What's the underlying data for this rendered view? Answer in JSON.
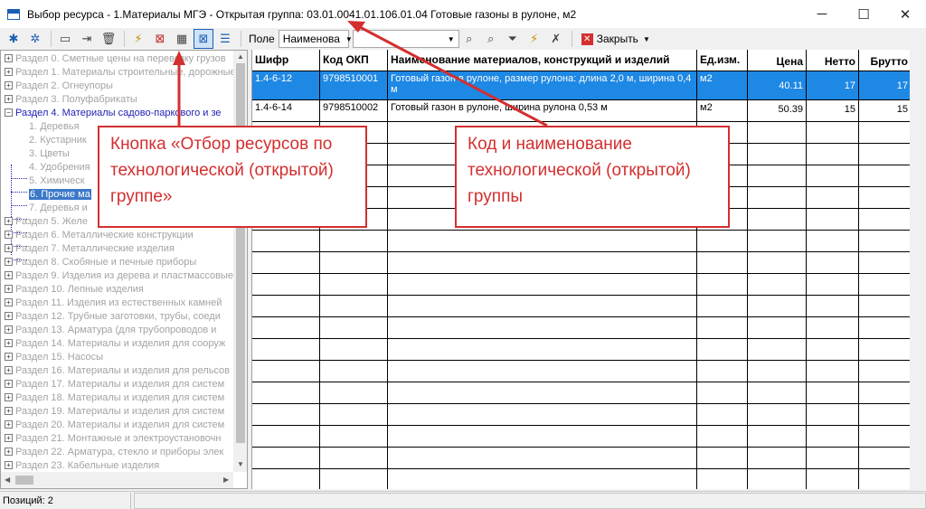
{
  "window": {
    "title": "Выбор ресурса - 1.Материалы МГЭ - Открытая группа: 03.01.0041.01.106.01.04 Готовые газоны в рулоне, м2",
    "minimize": "─",
    "maximize": "☐",
    "close": "✕"
  },
  "toolbar": {
    "field_label": "Поле",
    "field_value": "Наименова",
    "search_value": "",
    "close_label": "Закрыть"
  },
  "tree": {
    "items": [
      {
        "label": "Раздел 0. Сметные цены на перевозку грузов",
        "pm": "+"
      },
      {
        "label": "Раздел 1. Материалы строительные, дорожные",
        "pm": "+"
      },
      {
        "label": "Раздел 2. Огнеупоры",
        "pm": "+"
      },
      {
        "label": "Раздел 3. Полуфабрикаты",
        "pm": "+"
      },
      {
        "label": "Раздел 4. Материалы садово-паркового и зе",
        "pm": "−"
      },
      {
        "label": "1. Деревья"
      },
      {
        "label": "2. Кустарник"
      },
      {
        "label": "3. Цветы"
      },
      {
        "label": "4. Удобрения"
      },
      {
        "label": "5. Химическ"
      },
      {
        "label": "6. Прочие ма"
      },
      {
        "label": "7. Деревья и"
      },
      {
        "label": "Раздел 5. Желе",
        "pm": "+"
      },
      {
        "label": "Раздел 6. Металлические конструкции",
        "pm": "+"
      },
      {
        "label": "Раздел 7. Металлические изделия",
        "pm": "+"
      },
      {
        "label": "Раздел 8. Скобяные и печные приборы",
        "pm": "+"
      },
      {
        "label": "Раздел 9. Изделия из дерева и пластмассовые",
        "pm": "+"
      },
      {
        "label": "Раздел 10. Лепные изделия",
        "pm": "+"
      },
      {
        "label": "Раздел 11. Изделия из естественных камней",
        "pm": "+"
      },
      {
        "label": "Раздел 12. Трубные заготовки, трубы, соеди",
        "pm": "+"
      },
      {
        "label": "Раздел 13. Арматура (для трубопроводов и",
        "pm": "+"
      },
      {
        "label": "Раздел 14. Материалы и изделия для сооруж",
        "pm": "+"
      },
      {
        "label": "Раздел 15. Насосы",
        "pm": "+"
      },
      {
        "label": "Раздел 16. Материалы и изделия для рельсов",
        "pm": "+"
      },
      {
        "label": "Раздел 17. Материалы и изделия для систем",
        "pm": "+"
      },
      {
        "label": "Раздел 18. Материалы и изделия для систем",
        "pm": "+"
      },
      {
        "label": "Раздел 19. Материалы и изделия для систем",
        "pm": "+"
      },
      {
        "label": "Раздел 20. Материалы и изделия для систем",
        "pm": "+"
      },
      {
        "label": "Раздел 21. Монтажные и электроустановочн",
        "pm": "+"
      },
      {
        "label": "Раздел 22. Арматура, стекло и приборы элек",
        "pm": "+"
      },
      {
        "label": "Раздел 23. Кабельные изделия",
        "pm": "+"
      }
    ]
  },
  "grid": {
    "columns": [
      "Шифр",
      "Код ОКП",
      "Наименование материалов, конструкций и изделий",
      "Ед.изм.",
      "Цена",
      "Нетто",
      "Брутто"
    ],
    "rows": [
      {
        "code": "1.4-6-12",
        "okp": "9798510001",
        "name": "Готовый газон в рулоне, размер рулона: длина 2,0 м, ширина 0,4 м",
        "unit": "м2",
        "price": "40.11",
        "net": "17",
        "gross": "17"
      },
      {
        "code": "1.4-6-14",
        "okp": "9798510002",
        "name": "Готовый газон в рулоне, ширина рулона 0,53 м",
        "unit": "м2",
        "price": "50.39",
        "net": "15",
        "gross": "15"
      }
    ]
  },
  "status": {
    "positions": "Позиций: 2"
  },
  "annotations": {
    "left": "Кнопка «Отбор ресурсов по технологической (открытой) группе»",
    "right": "Код и наименование технологической (открытой) группы"
  },
  "colors": {
    "selected_row": "#1e88e5",
    "callout": "#d32f2f",
    "tree_open": "#1f1fb4"
  }
}
